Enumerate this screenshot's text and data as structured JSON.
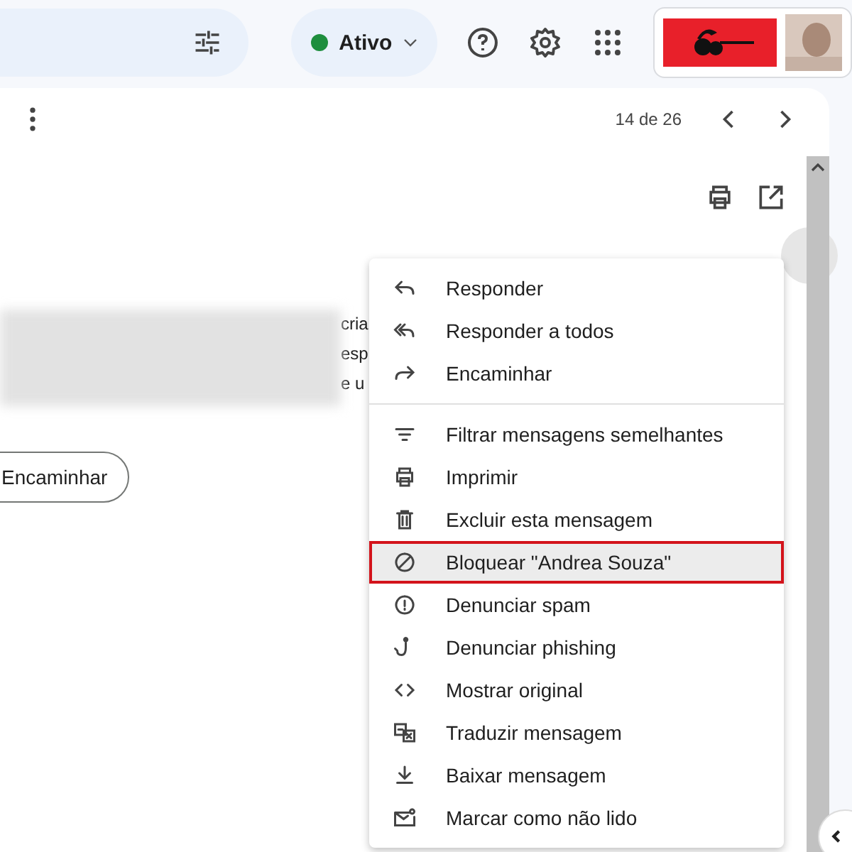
{
  "header": {
    "status": {
      "label": "Ativo",
      "color": "#1e8e3e"
    }
  },
  "toolbar": {
    "pagination": "14 de 26"
  },
  "body": {
    "fragments": [
      "cria",
      "esp",
      "e u"
    ],
    "forward_button": "Encaminhar"
  },
  "menu": {
    "groups": [
      [
        {
          "kind": "reply",
          "label": "Responder",
          "highlighted": false
        },
        {
          "kind": "reply-all",
          "label": "Responder a todos",
          "highlighted": false
        },
        {
          "kind": "forward",
          "label": "Encaminhar",
          "highlighted": false
        }
      ],
      [
        {
          "kind": "filter",
          "label": "Filtrar mensagens semelhantes",
          "highlighted": false
        },
        {
          "kind": "print",
          "label": "Imprimir",
          "highlighted": false
        },
        {
          "kind": "delete",
          "label": "Excluir esta mensagem",
          "highlighted": false
        },
        {
          "kind": "block",
          "label": "Bloquear \"Andrea Souza\"",
          "highlighted": true
        },
        {
          "kind": "spam",
          "label": "Denunciar spam",
          "highlighted": false
        },
        {
          "kind": "phishing",
          "label": "Denunciar phishing",
          "highlighted": false
        },
        {
          "kind": "code",
          "label": "Mostrar original",
          "highlighted": false
        },
        {
          "kind": "translate",
          "label": "Traduzir mensagem",
          "highlighted": false
        },
        {
          "kind": "download",
          "label": "Baixar mensagem",
          "highlighted": false
        },
        {
          "kind": "unread",
          "label": "Marcar como não lido",
          "highlighted": false
        }
      ]
    ]
  }
}
